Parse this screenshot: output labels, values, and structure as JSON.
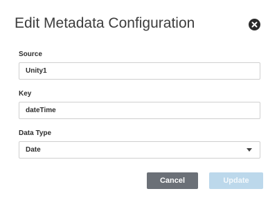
{
  "dialog": {
    "title": "Edit Metadata Configuration",
    "close_icon": "close-circle-icon"
  },
  "fields": {
    "source": {
      "label": "Source",
      "value": "Unity1"
    },
    "key": {
      "label": "Key",
      "value": "dateTime"
    },
    "data_type": {
      "label": "Data Type",
      "value": "Date",
      "caret_icon": "caret-down-icon"
    }
  },
  "buttons": {
    "cancel_label": "Cancel",
    "update_label": "Update",
    "update_disabled": true
  },
  "colors": {
    "cancel_bg": "#6b7077",
    "update_bg_disabled": "#bcd8eb",
    "border": "#cfcfcf"
  }
}
